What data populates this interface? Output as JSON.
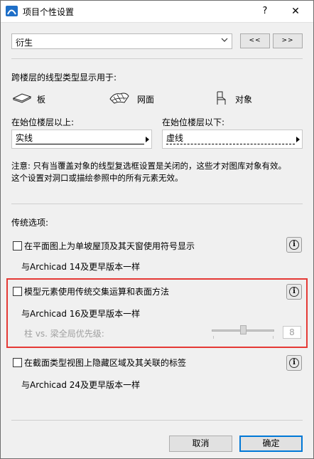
{
  "window": {
    "title": "项目个性设置",
    "help_label": "?",
    "close_label": "✕"
  },
  "profile": {
    "selected": "衍生",
    "prev_label": "<<",
    "next_label": ">>"
  },
  "line_types": {
    "heading": "跨楼层的线型类型显示用于:",
    "targets": [
      {
        "label": "板",
        "icon": "slab-icon"
      },
      {
        "label": "网面",
        "icon": "mesh-icon"
      },
      {
        "label": "对象",
        "icon": "object-chair-icon"
      }
    ],
    "above_label": "在始位楼层以上:",
    "above_value": "实线",
    "below_label": "在始位楼层以下:",
    "below_value": "虚线",
    "note_line1": "注意: 只有当覆盖对象的线型复选框设置是关闭的，这些才对图库对象有效。",
    "note_line2": "这个设置对洞口或描绘参照中的所有元素无效。"
  },
  "legacy": {
    "heading": "传统选项:",
    "options": [
      {
        "label": "在平面图上为单坡屋顶及其天窗使用符号显示",
        "sub": "与Archicad 14及更早版本一样",
        "checked": false
      },
      {
        "label": "模型元素使用传统交集运算和表面方法",
        "sub": "与Archicad 16及更早版本一样",
        "checked": false
      },
      {
        "label": "在截面类型视图上隐藏区域及其关联的标签",
        "sub": "与Archicad 24及更早版本一样",
        "checked": false
      }
    ],
    "priority_label": "柱 vs. 梁全局优先级:",
    "priority_value": "8",
    "priority_fraction": 0.5
  },
  "footer": {
    "cancel": "取消",
    "ok": "确定"
  },
  "colors": {
    "highlight": "#e53935",
    "accent": "#0078d7"
  }
}
